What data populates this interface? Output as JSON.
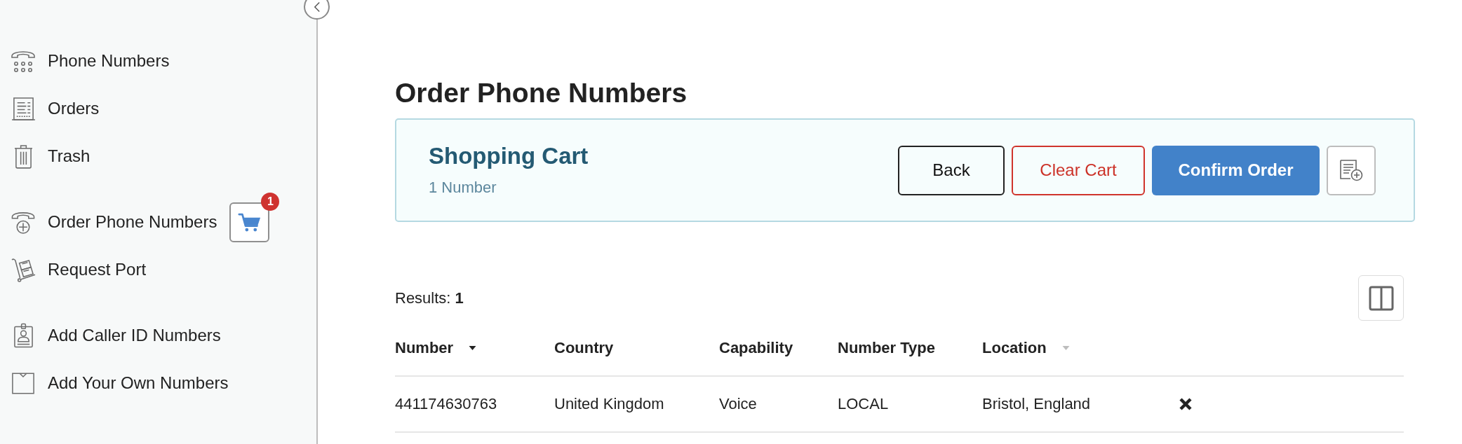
{
  "sidebar": {
    "groups": [
      {
        "items": [
          {
            "label": "Phone Numbers"
          },
          {
            "label": "Orders"
          },
          {
            "label": "Trash"
          }
        ]
      },
      {
        "items": [
          {
            "label": "Order Phone Numbers",
            "cart_badge": "1"
          },
          {
            "label": "Request Port"
          }
        ]
      },
      {
        "items": [
          {
            "label": "Add Caller ID Numbers"
          },
          {
            "label": "Add Your Own Numbers"
          }
        ]
      }
    ]
  },
  "page_title": "Order Phone Numbers",
  "cart_panel": {
    "title": "Shopping Cart",
    "count": "1 Number",
    "buttons": [
      {
        "kind": "outline",
        "label": "Back"
      },
      {
        "kind": "danger",
        "label": "Clear Cart"
      },
      {
        "kind": "primary",
        "label": "Confirm Order"
      },
      {
        "kind": "icon"
      }
    ]
  },
  "results": "Results: **1**",
  "table": {
    "columns": [
      {
        "label": "Number",
        "sortable": true,
        "sorted": true
      },
      {
        "label": "Country",
        "sortable": false,
        "sorted": false
      },
      {
        "label": "Capability",
        "sortable": false,
        "sorted": false
      },
      {
        "label": "Number Type",
        "sortable": false,
        "sorted": false
      },
      {
        "label": "Location",
        "sortable": true,
        "sorted": false
      }
    ],
    "rows": [
      {
        "cells": [
          "441174630763",
          "United Kingdom",
          "Voice",
          "LOCAL",
          "Bristol, England"
        ],
        "removable": true
      }
    ]
  }
}
